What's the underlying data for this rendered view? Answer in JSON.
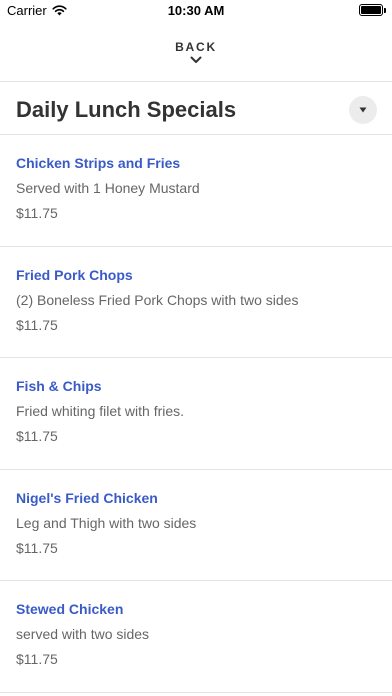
{
  "status_bar": {
    "carrier": "Carrier",
    "time": "10:30 AM",
    "battery_level": 1.0
  },
  "nav": {
    "back_label": "BACK",
    "back_icon": "chevron-down-icon"
  },
  "section": {
    "title": "Daily Lunch Specials",
    "toggle_icon": "caret-down-icon"
  },
  "colors": {
    "item_name": "#3a5bc7",
    "text_secondary": "#666666",
    "divider": "#e4e4e4"
  },
  "items": [
    {
      "name": "Chicken Strips and Fries",
      "description": "Served with 1 Honey Mustard",
      "price": "$11.75"
    },
    {
      "name": "Fried Pork Chops",
      "description": "(2) Boneless Fried Pork Chops with two sides",
      "price": "$11.75"
    },
    {
      "name": "Fish & Chips",
      "description": "Fried whiting filet with fries.",
      "price": "$11.75"
    },
    {
      "name": "Nigel's Fried Chicken",
      "description": "Leg and Thigh with two sides",
      "price": "$11.75"
    },
    {
      "name": "Stewed Chicken",
      "description": "served with two sides",
      "price": "$11.75"
    }
  ]
}
